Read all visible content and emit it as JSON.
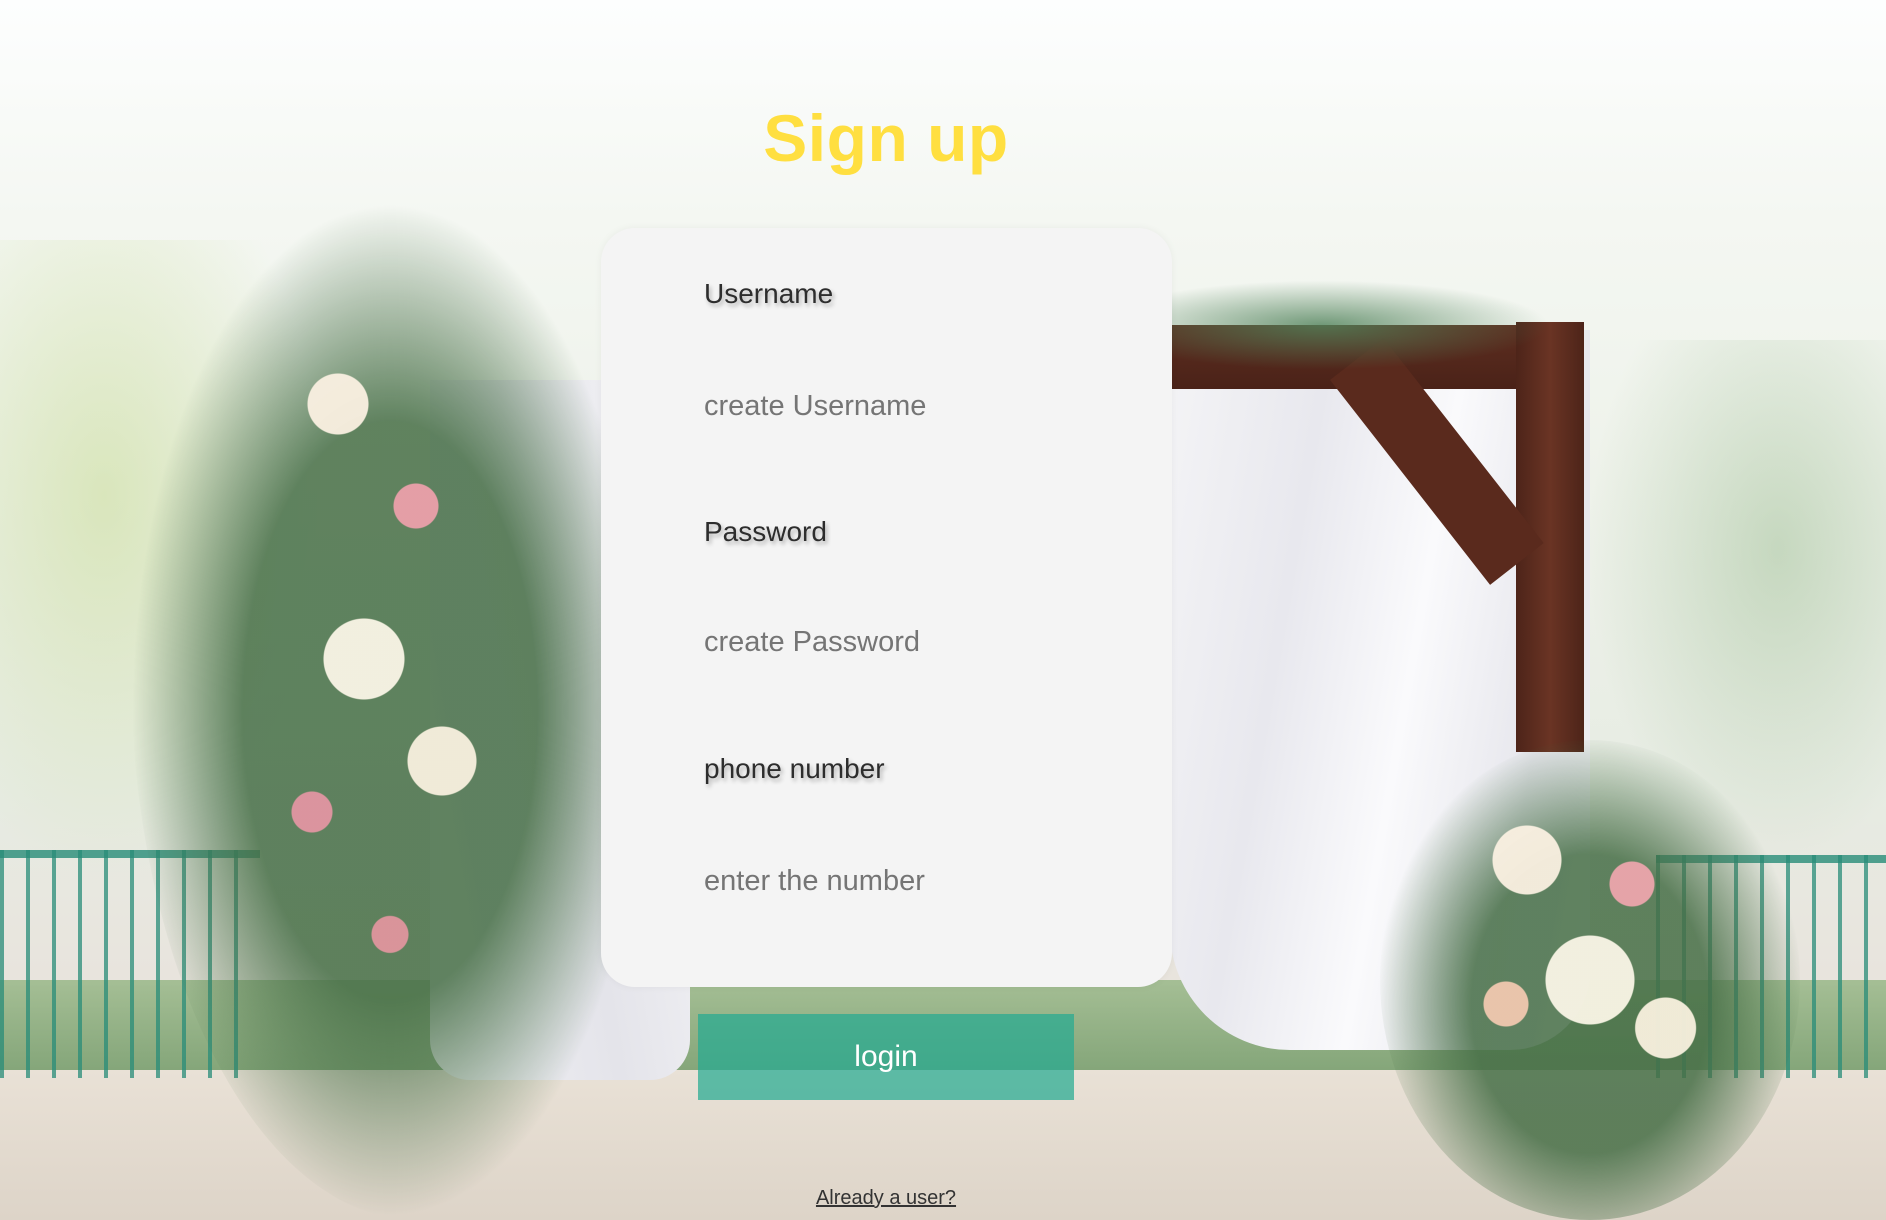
{
  "page": {
    "title": "Sign up",
    "title_color": "#ffdf40"
  },
  "form": {
    "username": {
      "label": "Username",
      "placeholder": "create Username"
    },
    "password": {
      "label": "Password",
      "placeholder": "create Password"
    },
    "phone": {
      "label": "phone number",
      "placeholder": "enter the number"
    },
    "submit_label": "login",
    "submit_color": "#26aa91"
  },
  "footer": {
    "already_user_link": "Already a user?"
  },
  "background": {
    "description_icon": "wedding-arch-photo"
  }
}
